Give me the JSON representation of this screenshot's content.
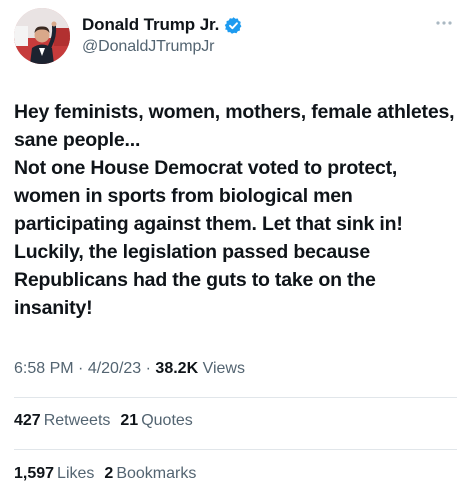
{
  "author": {
    "display_name": "Donald Trump Jr.",
    "handle": "@DonaldJTrumpJr",
    "verified": true,
    "avatar_icon": "profile-photo",
    "verified_icon": "verified-badge-icon",
    "verified_color": "#1d9bf0"
  },
  "tweet": {
    "text_lines": [
      "Hey feminists, women, mothers, female athletes, sane people...",
      "Not one House Democrat voted to protect, women in sports from biological men participating against them. Let that sink in! Luckily, the legislation passed because Republicans had the guts to take on the insanity!"
    ]
  },
  "meta": {
    "time": "6:58 PM",
    "dot1": " · ",
    "date": "4/20/23",
    "dot2": " · ",
    "views_count": "38.2K",
    "views_label": " Views"
  },
  "stats": {
    "retweets_count": "427",
    "retweets_label": "Retweets",
    "quotes_count": "21",
    "quotes_label": "Quotes",
    "likes_count": "1,597",
    "likes_label": "Likes",
    "bookmarks_count": "2",
    "bookmarks_label": "Bookmarks"
  },
  "more_icon": "more-horizontal-icon",
  "colors": {
    "text": "#0f1419",
    "secondary": "#536471",
    "divider": "#e1e6ea"
  }
}
